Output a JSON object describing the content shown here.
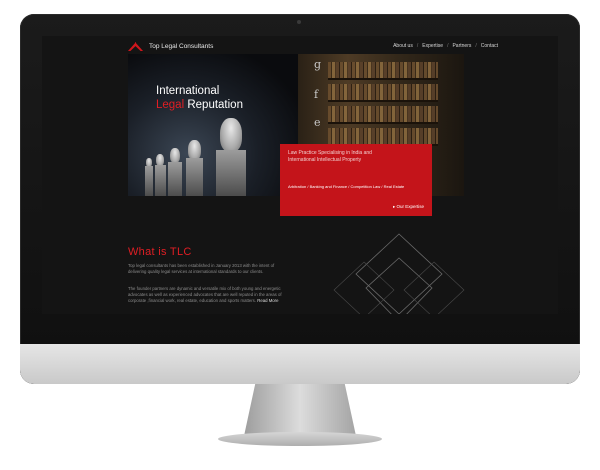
{
  "site": {
    "brand": "Top Legal Consultants",
    "nav": [
      {
        "label": "About us"
      },
      {
        "label": "Expertise"
      },
      {
        "label": "Partners"
      },
      {
        "label": "Contact"
      }
    ],
    "nav_sep": "/"
  },
  "hero": {
    "line1": "International",
    "line2_accent": "Legal",
    "line2_rest": "Reputation",
    "bg_letters": [
      "g",
      "f",
      "e"
    ]
  },
  "callout": {
    "lead": "Law Practice Specialising in India and International Intellectual Property",
    "areas": "Arbitration / Banking and Finance / Competition Law / Real Estate",
    "cta": "▸ Our Expertise"
  },
  "about": {
    "title": "What is TLC",
    "para1": "Top legal consultants has been established in January 2013 with the intent of delivering quality legal services at international standards to our clients.",
    "para2": "The founder partners are dynamic and versatile mix of both young and energetic advocates as well as experienced advocates that are well reputed in the areas of corporate ,financial work, real estate, education and sports matters.",
    "read_more": "Read More"
  },
  "colors": {
    "accent": "#e01e24",
    "callout_bg": "#c4141a",
    "screen_bg": "#141414"
  },
  "icons": {
    "logo": "logo-mark-icon",
    "diamond": "diamond-outline-icon",
    "cta_arrow": "play-arrow-icon"
  }
}
